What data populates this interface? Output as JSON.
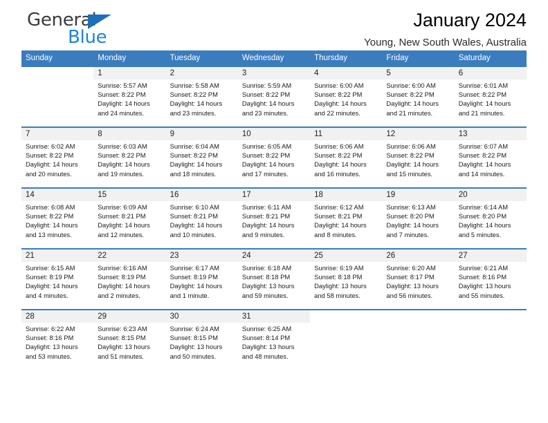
{
  "brand": {
    "name_part1": "General",
    "name_part2": "Blue",
    "accent_color": "#1d85d6",
    "triangle_color": "#1d6fb8"
  },
  "header": {
    "title": "January 2024",
    "subtitle": "Young, New South Wales, Australia",
    "header_bg_color": "#3a7cbe"
  },
  "calendar": {
    "weekday_headers": [
      "Sunday",
      "Monday",
      "Tuesday",
      "Wednesday",
      "Thursday",
      "Friday",
      "Saturday"
    ],
    "weeks": [
      [
        {
          "day": "",
          "lines": []
        },
        {
          "day": "1",
          "lines": [
            "Sunrise: 5:57 AM",
            "Sunset: 8:22 PM",
            "Daylight: 14 hours",
            "and 24 minutes."
          ]
        },
        {
          "day": "2",
          "lines": [
            "Sunrise: 5:58 AM",
            "Sunset: 8:22 PM",
            "Daylight: 14 hours",
            "and 23 minutes."
          ]
        },
        {
          "day": "3",
          "lines": [
            "Sunrise: 5:59 AM",
            "Sunset: 8:22 PM",
            "Daylight: 14 hours",
            "and 23 minutes."
          ]
        },
        {
          "day": "4",
          "lines": [
            "Sunrise: 6:00 AM",
            "Sunset: 8:22 PM",
            "Daylight: 14 hours",
            "and 22 minutes."
          ]
        },
        {
          "day": "5",
          "lines": [
            "Sunrise: 6:00 AM",
            "Sunset: 8:22 PM",
            "Daylight: 14 hours",
            "and 21 minutes."
          ]
        },
        {
          "day": "6",
          "lines": [
            "Sunrise: 6:01 AM",
            "Sunset: 8:22 PM",
            "Daylight: 14 hours",
            "and 21 minutes."
          ]
        }
      ],
      [
        {
          "day": "7",
          "lines": [
            "Sunrise: 6:02 AM",
            "Sunset: 8:22 PM",
            "Daylight: 14 hours",
            "and 20 minutes."
          ]
        },
        {
          "day": "8",
          "lines": [
            "Sunrise: 6:03 AM",
            "Sunset: 8:22 PM",
            "Daylight: 14 hours",
            "and 19 minutes."
          ]
        },
        {
          "day": "9",
          "lines": [
            "Sunrise: 6:04 AM",
            "Sunset: 8:22 PM",
            "Daylight: 14 hours",
            "and 18 minutes."
          ]
        },
        {
          "day": "10",
          "lines": [
            "Sunrise: 6:05 AM",
            "Sunset: 8:22 PM",
            "Daylight: 14 hours",
            "and 17 minutes."
          ]
        },
        {
          "day": "11",
          "lines": [
            "Sunrise: 6:06 AM",
            "Sunset: 8:22 PM",
            "Daylight: 14 hours",
            "and 16 minutes."
          ]
        },
        {
          "day": "12",
          "lines": [
            "Sunrise: 6:06 AM",
            "Sunset: 8:22 PM",
            "Daylight: 14 hours",
            "and 15 minutes."
          ]
        },
        {
          "day": "13",
          "lines": [
            "Sunrise: 6:07 AM",
            "Sunset: 8:22 PM",
            "Daylight: 14 hours",
            "and 14 minutes."
          ]
        }
      ],
      [
        {
          "day": "14",
          "lines": [
            "Sunrise: 6:08 AM",
            "Sunset: 8:22 PM",
            "Daylight: 14 hours",
            "and 13 minutes."
          ]
        },
        {
          "day": "15",
          "lines": [
            "Sunrise: 6:09 AM",
            "Sunset: 8:21 PM",
            "Daylight: 14 hours",
            "and 12 minutes."
          ]
        },
        {
          "day": "16",
          "lines": [
            "Sunrise: 6:10 AM",
            "Sunset: 8:21 PM",
            "Daylight: 14 hours",
            "and 10 minutes."
          ]
        },
        {
          "day": "17",
          "lines": [
            "Sunrise: 6:11 AM",
            "Sunset: 8:21 PM",
            "Daylight: 14 hours",
            "and 9 minutes."
          ]
        },
        {
          "day": "18",
          "lines": [
            "Sunrise: 6:12 AM",
            "Sunset: 8:21 PM",
            "Daylight: 14 hours",
            "and 8 minutes."
          ]
        },
        {
          "day": "19",
          "lines": [
            "Sunrise: 6:13 AM",
            "Sunset: 8:20 PM",
            "Daylight: 14 hours",
            "and 7 minutes."
          ]
        },
        {
          "day": "20",
          "lines": [
            "Sunrise: 6:14 AM",
            "Sunset: 8:20 PM",
            "Daylight: 14 hours",
            "and 5 minutes."
          ]
        }
      ],
      [
        {
          "day": "21",
          "lines": [
            "Sunrise: 6:15 AM",
            "Sunset: 8:19 PM",
            "Daylight: 14 hours",
            "and 4 minutes."
          ]
        },
        {
          "day": "22",
          "lines": [
            "Sunrise: 6:16 AM",
            "Sunset: 8:19 PM",
            "Daylight: 14 hours",
            "and 2 minutes."
          ]
        },
        {
          "day": "23",
          "lines": [
            "Sunrise: 6:17 AM",
            "Sunset: 8:19 PM",
            "Daylight: 14 hours",
            "and 1 minute."
          ]
        },
        {
          "day": "24",
          "lines": [
            "Sunrise: 6:18 AM",
            "Sunset: 8:18 PM",
            "Daylight: 13 hours",
            "and 59 minutes."
          ]
        },
        {
          "day": "25",
          "lines": [
            "Sunrise: 6:19 AM",
            "Sunset: 8:18 PM",
            "Daylight: 13 hours",
            "and 58 minutes."
          ]
        },
        {
          "day": "26",
          "lines": [
            "Sunrise: 6:20 AM",
            "Sunset: 8:17 PM",
            "Daylight: 13 hours",
            "and 56 minutes."
          ]
        },
        {
          "day": "27",
          "lines": [
            "Sunrise: 6:21 AM",
            "Sunset: 8:16 PM",
            "Daylight: 13 hours",
            "and 55 minutes."
          ]
        }
      ],
      [
        {
          "day": "28",
          "lines": [
            "Sunrise: 6:22 AM",
            "Sunset: 8:16 PM",
            "Daylight: 13 hours",
            "and 53 minutes."
          ]
        },
        {
          "day": "29",
          "lines": [
            "Sunrise: 6:23 AM",
            "Sunset: 8:15 PM",
            "Daylight: 13 hours",
            "and 51 minutes."
          ]
        },
        {
          "day": "30",
          "lines": [
            "Sunrise: 6:24 AM",
            "Sunset: 8:15 PM",
            "Daylight: 13 hours",
            "and 50 minutes."
          ]
        },
        {
          "day": "31",
          "lines": [
            "Sunrise: 6:25 AM",
            "Sunset: 8:14 PM",
            "Daylight: 13 hours",
            "and 48 minutes."
          ]
        },
        {
          "day": "",
          "lines": []
        },
        {
          "day": "",
          "lines": []
        },
        {
          "day": "",
          "lines": []
        }
      ]
    ]
  }
}
